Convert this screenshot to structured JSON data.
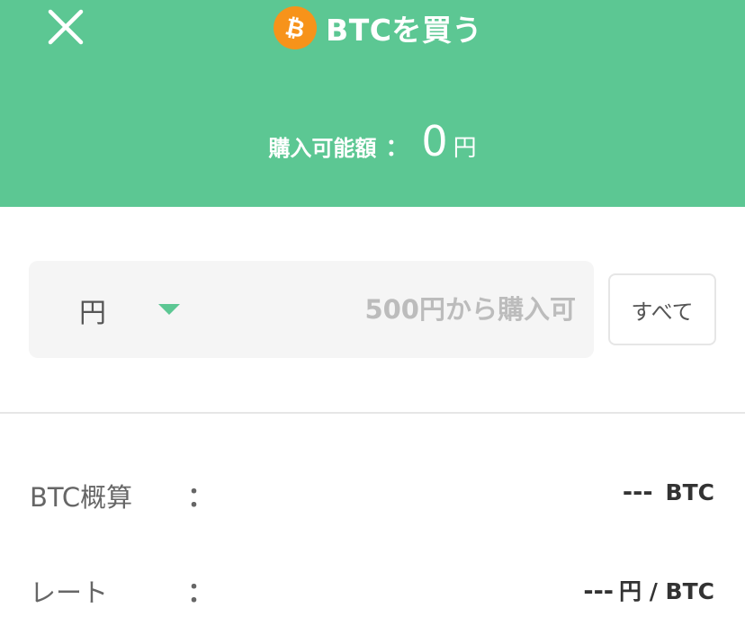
{
  "header": {
    "title": "BTCを買う",
    "close_icon": "close-icon",
    "coin_icon": "bitcoin-icon",
    "coin_color": "#f7931a",
    "background_color": "#5cc793",
    "available_label": "購入可能額",
    "available_colon": "：",
    "available_value": "0",
    "available_unit": "円"
  },
  "amount": {
    "currency_label": "円",
    "placeholder": "500円から購入可",
    "value": ""
  },
  "all_button_label": "すべて",
  "estimate": {
    "label": "BTC概算",
    "colon": "：",
    "value": "---",
    "unit": "BTC"
  },
  "rate": {
    "label": "レート",
    "colon": "：",
    "value": "---",
    "unit": "円 / BTC"
  }
}
